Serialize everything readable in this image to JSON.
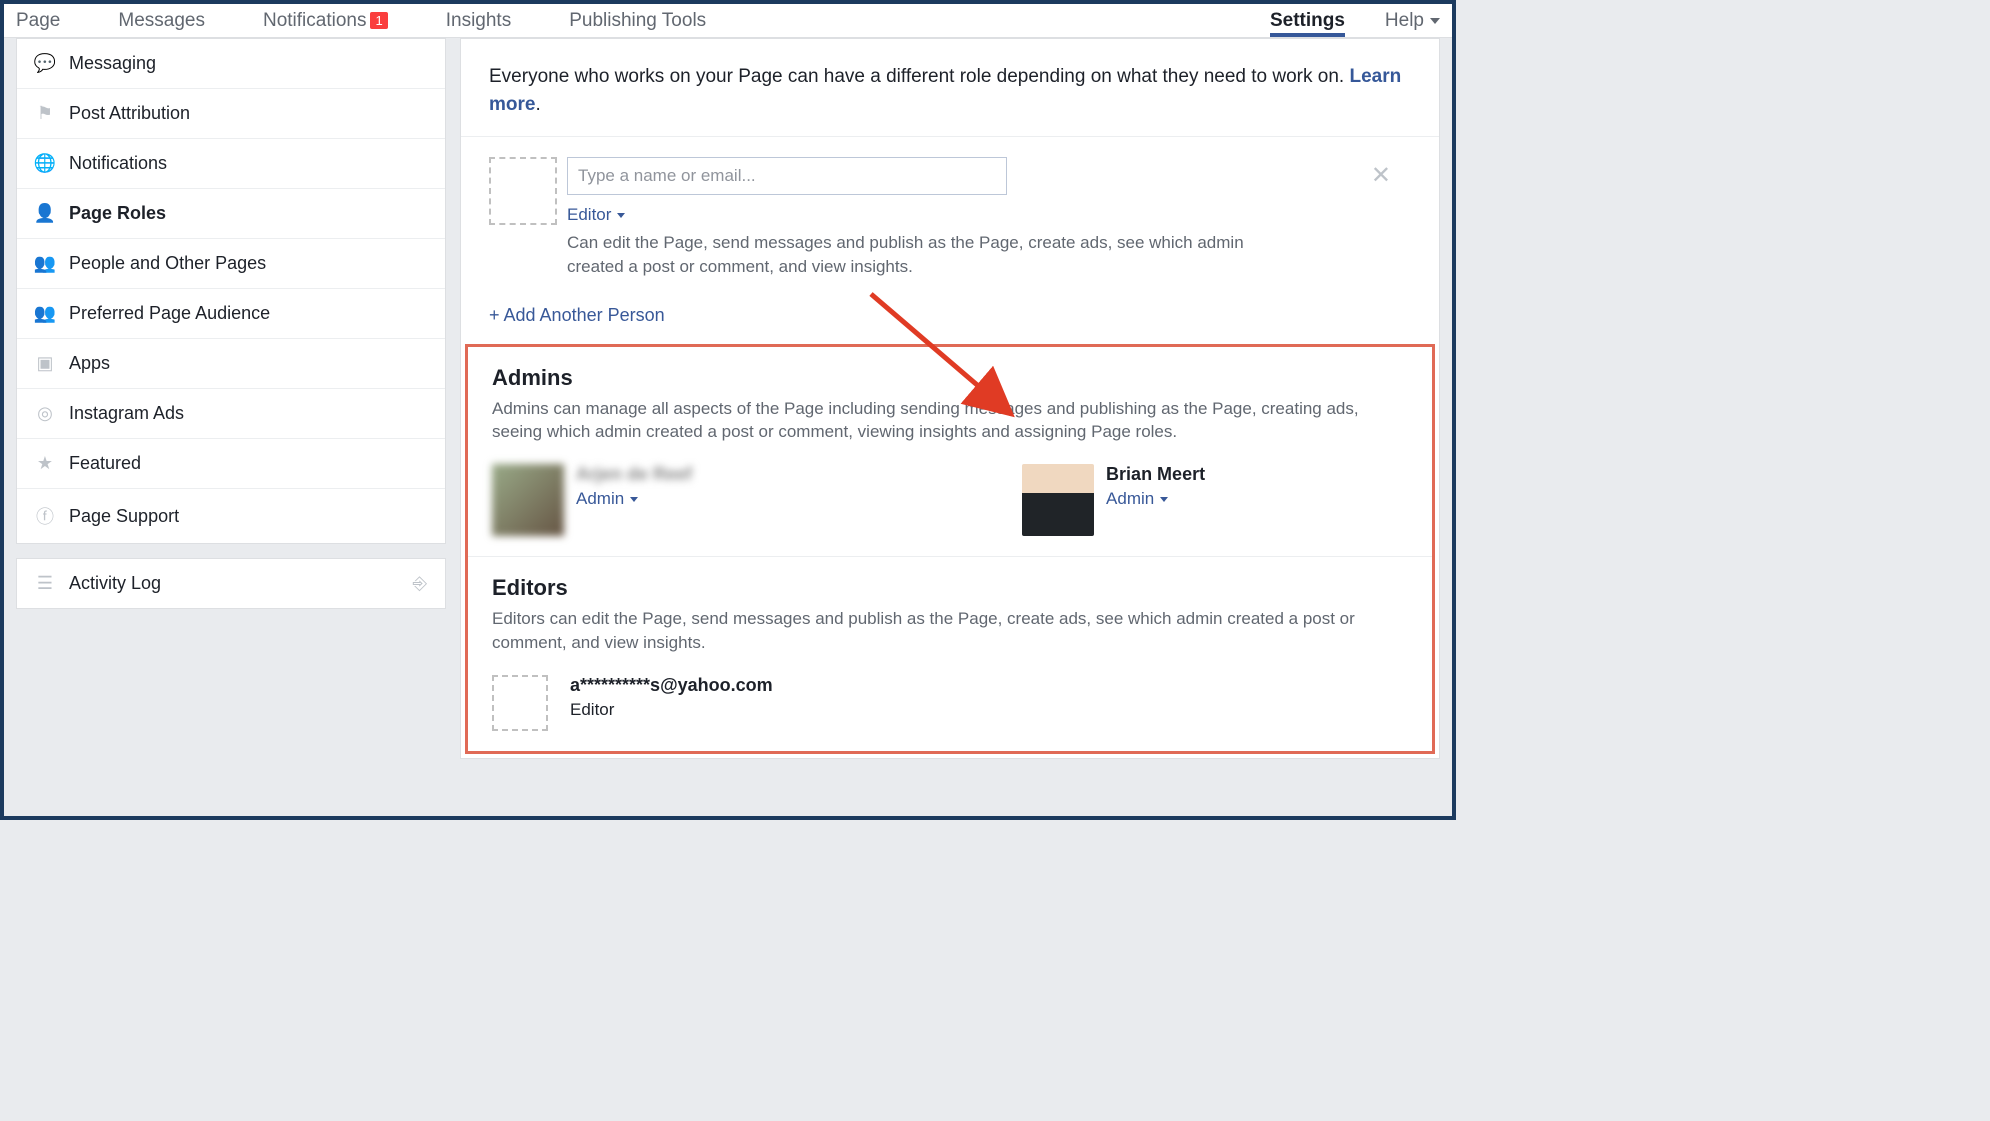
{
  "topnav": {
    "items": [
      {
        "label": "Page"
      },
      {
        "label": "Messages"
      },
      {
        "label": "Notifications",
        "badge": "1"
      },
      {
        "label": "Insights"
      },
      {
        "label": "Publishing Tools"
      }
    ],
    "right": [
      {
        "label": "Settings",
        "active": true
      },
      {
        "label": "Help",
        "dropdown": true
      }
    ]
  },
  "sidebar": {
    "items": [
      {
        "label": "Messaging",
        "icon": "chat"
      },
      {
        "label": "Post Attribution",
        "icon": "flag"
      },
      {
        "label": "Notifications",
        "icon": "globe"
      },
      {
        "label": "Page Roles",
        "icon": "person",
        "active": true
      },
      {
        "label": "People and Other Pages",
        "icon": "people"
      },
      {
        "label": "Preferred Page Audience",
        "icon": "people"
      },
      {
        "label": "Apps",
        "icon": "box"
      },
      {
        "label": "Instagram Ads",
        "icon": "instagram"
      },
      {
        "label": "Featured",
        "icon": "star"
      },
      {
        "label": "Page Support",
        "icon": "fb"
      }
    ],
    "activity": {
      "label": "Activity Log",
      "icon": "list"
    }
  },
  "main": {
    "intro_text": "Everyone who works on your Page can have a different role depending on what they need to work on. ",
    "learn_more": "Learn more",
    "add_person": {
      "placeholder": "Type a name or email...",
      "role": "Editor",
      "desc": "Can edit the Page, send messages and publish as the Page, create ads, see which admin created a post or comment, and view insights."
    },
    "add_another": "+ Add Another Person",
    "admins": {
      "title": "Admins",
      "desc": "Admins can manage all aspects of the Page including sending messages and publishing as the Page, creating ads, seeing which admin created a post or comment, viewing insights and assigning Page roles.",
      "people": [
        {
          "name": "Arjen de Reef",
          "role": "Admin",
          "blur": true
        },
        {
          "name": "Brian Meert",
          "role": "Admin",
          "blur": false
        }
      ]
    },
    "editors": {
      "title": "Editors",
      "desc": "Editors can edit the Page, send messages and publish as the Page, create ads, see which admin created a post or comment, and view insights.",
      "people": [
        {
          "name": "a**********s@yahoo.com",
          "role": "Editor",
          "dashed": true
        }
      ]
    }
  }
}
